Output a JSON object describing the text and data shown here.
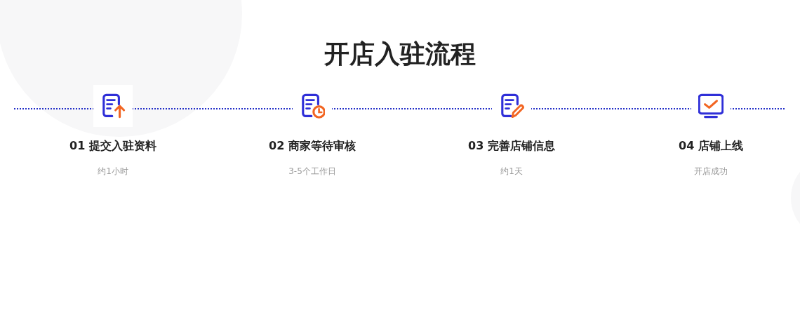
{
  "title": "开店入驻流程",
  "steps": [
    {
      "kind": "upload",
      "label": "01 提交入驻资料",
      "note": "约1小时"
    },
    {
      "kind": "clock",
      "label": "02 商家等待审核",
      "note": "3-5个工作日"
    },
    {
      "kind": "edit",
      "label": "03 完善店铺信息",
      "note": "约1天"
    },
    {
      "kind": "check",
      "label": "04 店铺上线",
      "note": "开店成功"
    }
  ]
}
